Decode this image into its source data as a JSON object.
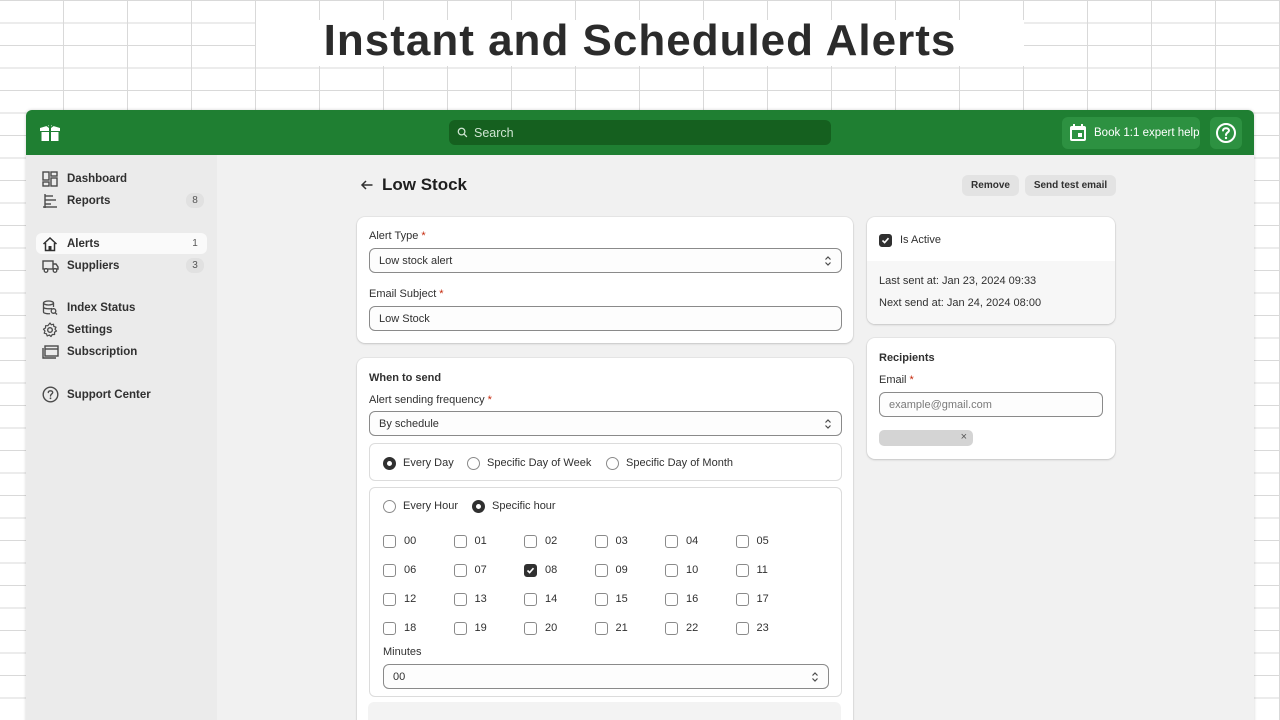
{
  "hero": {
    "title": "Instant and Scheduled Alerts"
  },
  "topbar": {
    "search_placeholder": "Search",
    "book_label": "Book 1:1 expert help"
  },
  "sidebar": {
    "dashboard": "Dashboard",
    "reports": "Reports",
    "reports_count": "8",
    "alerts": "Alerts",
    "alerts_count": "1",
    "suppliers": "Suppliers",
    "suppliers_count": "3",
    "index_status": "Index Status",
    "settings": "Settings",
    "subscription": "Subscription",
    "support_center": "Support Center"
  },
  "page": {
    "title": "Low Stock",
    "remove_label": "Remove",
    "send_test_label": "Send test email"
  },
  "alert_form": {
    "alert_type_label": "Alert Type",
    "alert_type_value": "Low stock alert",
    "email_subject_label": "Email Subject",
    "email_subject_value": "Low Stock",
    "required_mark": "*"
  },
  "schedule": {
    "section_title": "When to send",
    "frequency_label": "Alert sending frequency",
    "frequency_value": "By schedule",
    "day_options": [
      "Every Day",
      "Specific Day of Week",
      "Specific Day of Month"
    ],
    "day_selected": "Every Day",
    "hour_options": [
      "Every Hour",
      "Specific hour"
    ],
    "hour_selected": "Specific hour",
    "hours": [
      "00",
      "01",
      "02",
      "03",
      "04",
      "05",
      "06",
      "07",
      "08",
      "09",
      "10",
      "11",
      "12",
      "13",
      "14",
      "15",
      "16",
      "17",
      "18",
      "19",
      "20",
      "21",
      "22",
      "23"
    ],
    "hours_checked": [
      "08"
    ],
    "minutes_label": "Minutes",
    "minutes_value": "00"
  },
  "status": {
    "is_active_label": "Is Active",
    "is_active": true,
    "last_sent": "Last sent at: Jan 23, 2024 09:33",
    "next_send": "Next send at: Jan 24, 2024 08:00"
  },
  "recipients": {
    "title": "Recipients",
    "email_label": "Email",
    "email_placeholder": "example@gmail.com",
    "tag_remove": "×"
  },
  "colors": {
    "topbar": "#1f7f32",
    "search_bg": "#15601f",
    "accent_button": "#2d9141",
    "required": "#c5290c"
  }
}
